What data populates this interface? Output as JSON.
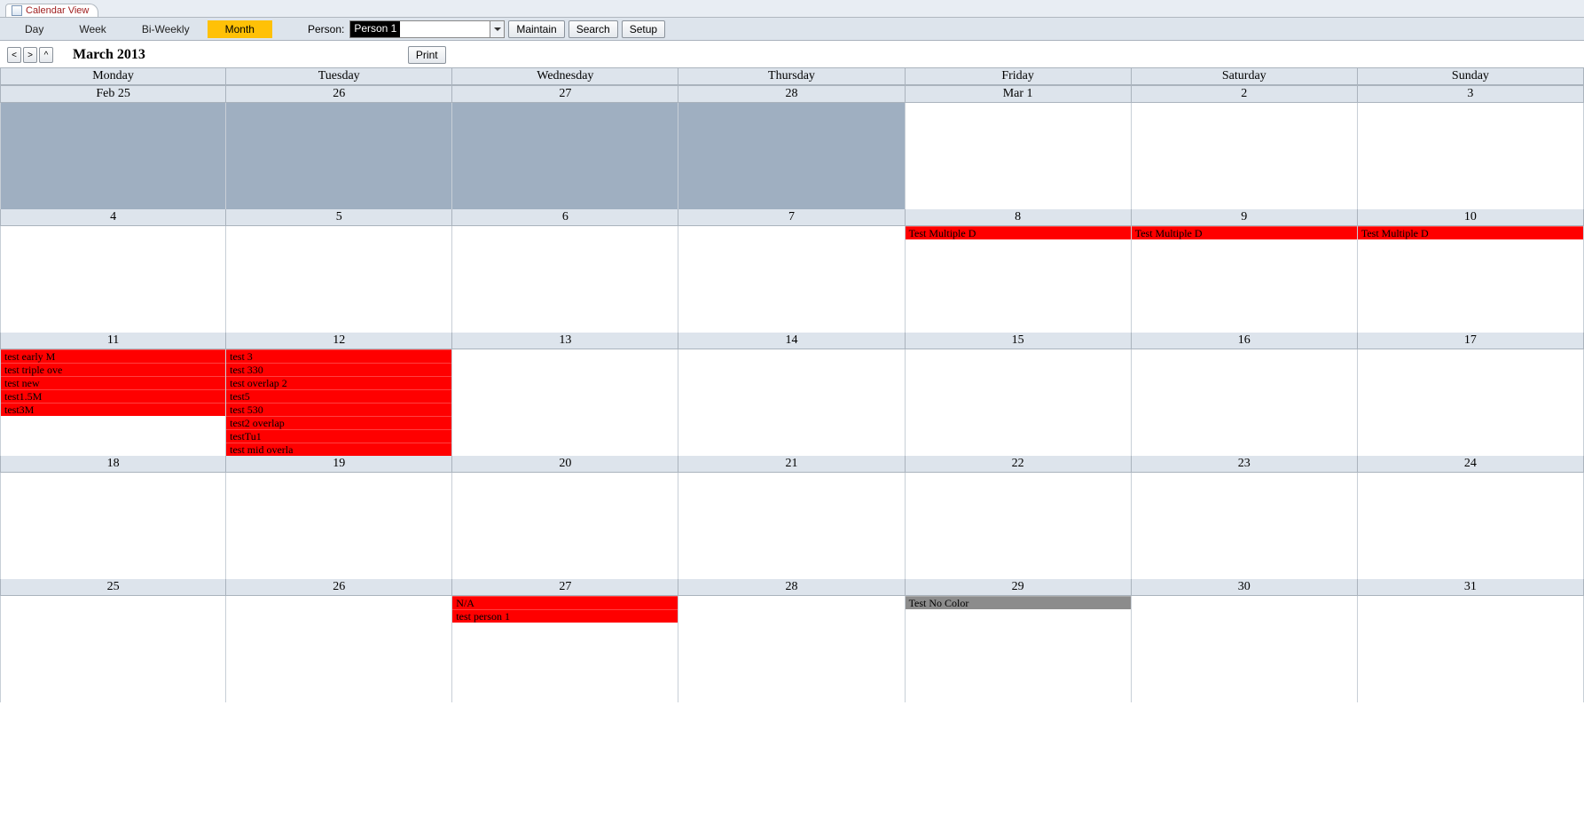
{
  "tab": {
    "title": "Calendar View"
  },
  "toolbar": {
    "views": [
      "Day",
      "Week",
      "Bi-Weekly",
      "Month"
    ],
    "active_view_index": 3,
    "person_label": "Person:",
    "person_value": "Person 1",
    "maintain": "Maintain",
    "search": "Search",
    "setup": "Setup"
  },
  "nav": {
    "prev": "<",
    "next": ">",
    "up": "^",
    "title": "March 2013",
    "print": "Print"
  },
  "days": [
    "Monday",
    "Tuesday",
    "Wednesday",
    "Thursday",
    "Friday",
    "Saturday",
    "Sunday"
  ],
  "weeks": [
    {
      "dates": [
        "Feb 25",
        "26",
        "27",
        "28",
        "Mar 1",
        "2",
        "3"
      ],
      "cells": [
        {
          "off": true,
          "events": []
        },
        {
          "off": true,
          "events": []
        },
        {
          "off": true,
          "events": []
        },
        {
          "off": true,
          "events": []
        },
        {
          "off": false,
          "events": []
        },
        {
          "off": false,
          "events": []
        },
        {
          "off": false,
          "events": []
        }
      ]
    },
    {
      "dates": [
        "4",
        "5",
        "6",
        "7",
        "8",
        "9",
        "10"
      ],
      "cells": [
        {
          "off": false,
          "events": []
        },
        {
          "off": false,
          "events": []
        },
        {
          "off": false,
          "events": []
        },
        {
          "off": false,
          "events": []
        },
        {
          "off": false,
          "events": [
            {
              "t": "Test Multiple D",
              "c": "ev-red"
            }
          ]
        },
        {
          "off": false,
          "events": [
            {
              "t": "Test Multiple D",
              "c": "ev-red"
            }
          ]
        },
        {
          "off": false,
          "events": [
            {
              "t": "Test Multiple D",
              "c": "ev-red"
            }
          ]
        }
      ]
    },
    {
      "dates": [
        "11",
        "12",
        "13",
        "14",
        "15",
        "16",
        "17"
      ],
      "cells": [
        {
          "off": false,
          "events": [
            {
              "t": "test early M",
              "c": "ev-red"
            },
            {
              "t": "test triple ove",
              "c": "ev-red"
            },
            {
              "t": "test new",
              "c": "ev-red"
            },
            {
              "t": "test1.5M",
              "c": "ev-red"
            },
            {
              "t": "test3M",
              "c": "ev-red"
            }
          ]
        },
        {
          "off": false,
          "events": [
            {
              "t": "test 3",
              "c": "ev-red"
            },
            {
              "t": "test 330",
              "c": "ev-red"
            },
            {
              "t": "test overlap 2",
              "c": "ev-red"
            },
            {
              "t": "test5",
              "c": "ev-red"
            },
            {
              "t": "test 530",
              "c": "ev-red"
            },
            {
              "t": "test2 overlap",
              "c": "ev-red"
            },
            {
              "t": "testTu1",
              "c": "ev-red"
            },
            {
              "t": "test mid overla",
              "c": "ev-red"
            }
          ]
        },
        {
          "off": false,
          "events": []
        },
        {
          "off": false,
          "events": []
        },
        {
          "off": false,
          "events": []
        },
        {
          "off": false,
          "events": []
        },
        {
          "off": false,
          "events": []
        }
      ]
    },
    {
      "dates": [
        "18",
        "19",
        "20",
        "21",
        "22",
        "23",
        "24"
      ],
      "cells": [
        {
          "off": false,
          "events": []
        },
        {
          "off": false,
          "events": []
        },
        {
          "off": false,
          "events": []
        },
        {
          "off": false,
          "events": []
        },
        {
          "off": false,
          "events": []
        },
        {
          "off": false,
          "events": []
        },
        {
          "off": false,
          "events": []
        }
      ]
    },
    {
      "dates": [
        "25",
        "26",
        "27",
        "28",
        "29",
        "30",
        "31"
      ],
      "cells": [
        {
          "off": false,
          "events": []
        },
        {
          "off": false,
          "events": []
        },
        {
          "off": false,
          "events": [
            {
              "t": "N/A",
              "c": "ev-red"
            },
            {
              "t": "test person 1",
              "c": "ev-red"
            }
          ]
        },
        {
          "off": false,
          "events": []
        },
        {
          "off": false,
          "events": [
            {
              "t": "Test No Color",
              "c": "ev-gray"
            }
          ]
        },
        {
          "off": false,
          "events": []
        },
        {
          "off": false,
          "events": []
        }
      ]
    }
  ]
}
